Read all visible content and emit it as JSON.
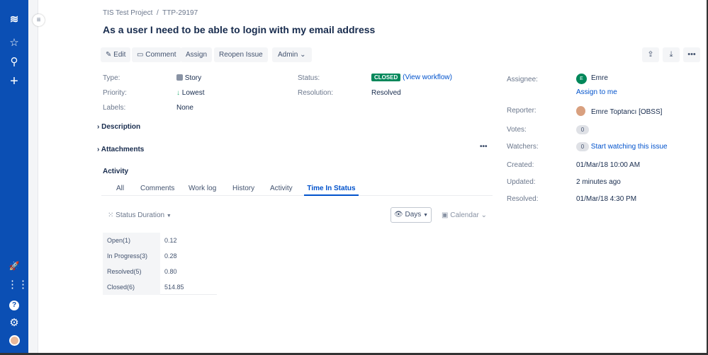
{
  "nav": {
    "icons": [
      "jira-logo-icon",
      "star-icon",
      "search-icon",
      "plus-icon",
      "rocket-icon",
      "apps-grid-icon",
      "help-icon",
      "gear-icon",
      "user-avatar"
    ]
  },
  "breadcrumb": {
    "project": "TIS Test Project",
    "separator": "/",
    "issue_key": "TTP-29197"
  },
  "issue": {
    "title": "As a user I need to be able to login with my email address"
  },
  "toolbar": {
    "edit": "Edit",
    "comment": "Comment",
    "assign": "Assign",
    "reopen": "Reopen Issue",
    "admin": "Admin"
  },
  "details": {
    "type_label": "Type:",
    "type_value": "Story",
    "priority_label": "Priority:",
    "priority_value": "Lowest",
    "labels_label": "Labels:",
    "labels_value": "None",
    "status_label": "Status:",
    "status_value": "CLOSED",
    "status_link": "(View workflow)",
    "resolution_label": "Resolution:",
    "resolution_value": "Resolved"
  },
  "sections": {
    "description": "Description",
    "attachments": "Attachments",
    "activity": "Activity"
  },
  "tabs": [
    "All",
    "Comments",
    "Work log",
    "History",
    "Activity",
    "Time In Status"
  ],
  "tis": {
    "status_duration": "Status Duration",
    "days": "Days",
    "calendar": "Calendar",
    "rows": [
      {
        "status": "Open(1)",
        "value": "0.12"
      },
      {
        "status": "In Progress(3)",
        "value": "0.28"
      },
      {
        "status": "Resolved(5)",
        "value": "0.80"
      },
      {
        "status": "Closed(6)",
        "value": "514.85"
      }
    ]
  },
  "people": {
    "assignee_label": "Assignee:",
    "assignee_initial": "E",
    "assignee": "Emre",
    "assign_to_me": "Assign to me",
    "reporter_label": "Reporter:",
    "reporter": "Emre Toptancı [OBSS]",
    "votes_label": "Votes:",
    "votes": "0",
    "watchers_label": "Watchers:",
    "watchers": "0",
    "watch_link": "Start watching this issue"
  },
  "dates": {
    "created_label": "Created:",
    "created": "01/Mar/18 10:00 AM",
    "updated_label": "Updated:",
    "updated": "2 minutes ago",
    "resolved_label": "Resolved:",
    "resolved": "01/Mar/18 4:30 PM"
  },
  "colors": {
    "nav": "#0b4fb4",
    "closed": "#00875a",
    "link": "#0052cc"
  }
}
